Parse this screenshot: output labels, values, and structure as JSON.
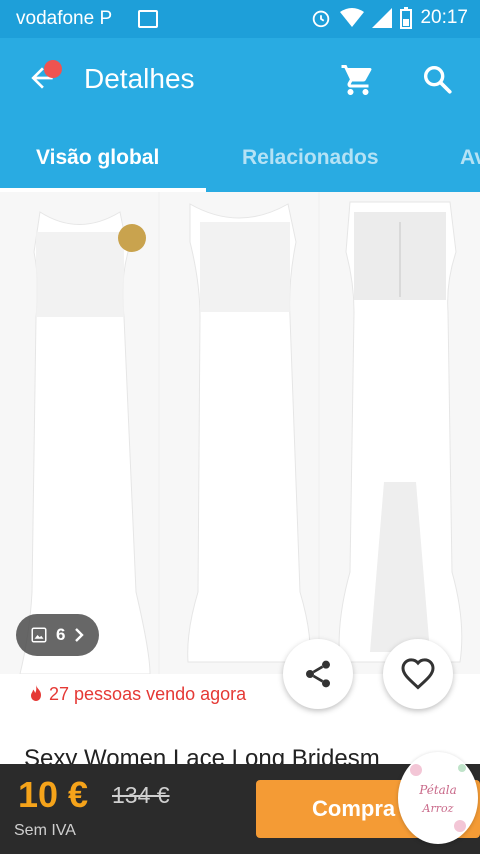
{
  "status_bar": {
    "carrier": "vodafone P",
    "time": "20:17"
  },
  "app_bar": {
    "title": "Detalhes"
  },
  "tabs": [
    {
      "label": "Visão global",
      "active": true
    },
    {
      "label": "Relacionados",
      "active": false
    },
    {
      "label": "Av",
      "active": false
    }
  ],
  "gallery": {
    "image_count": "6",
    "viewers_text": "27 pessoas vendo agora"
  },
  "product": {
    "title": "Sexy Women Lace Long Bridesm"
  },
  "bottom_bar": {
    "price": "10 €",
    "old_price": "134 €",
    "vat_note": "Sem IVA",
    "buy_label": "Compra"
  },
  "badge": {
    "line1": "Pétala",
    "line2": "Arroz"
  },
  "colors": {
    "primary": "#29abe2",
    "status_bar": "#1e9fd9",
    "price": "#f5a31a",
    "buy_button": "#f49b35",
    "alert": "#e53935"
  }
}
